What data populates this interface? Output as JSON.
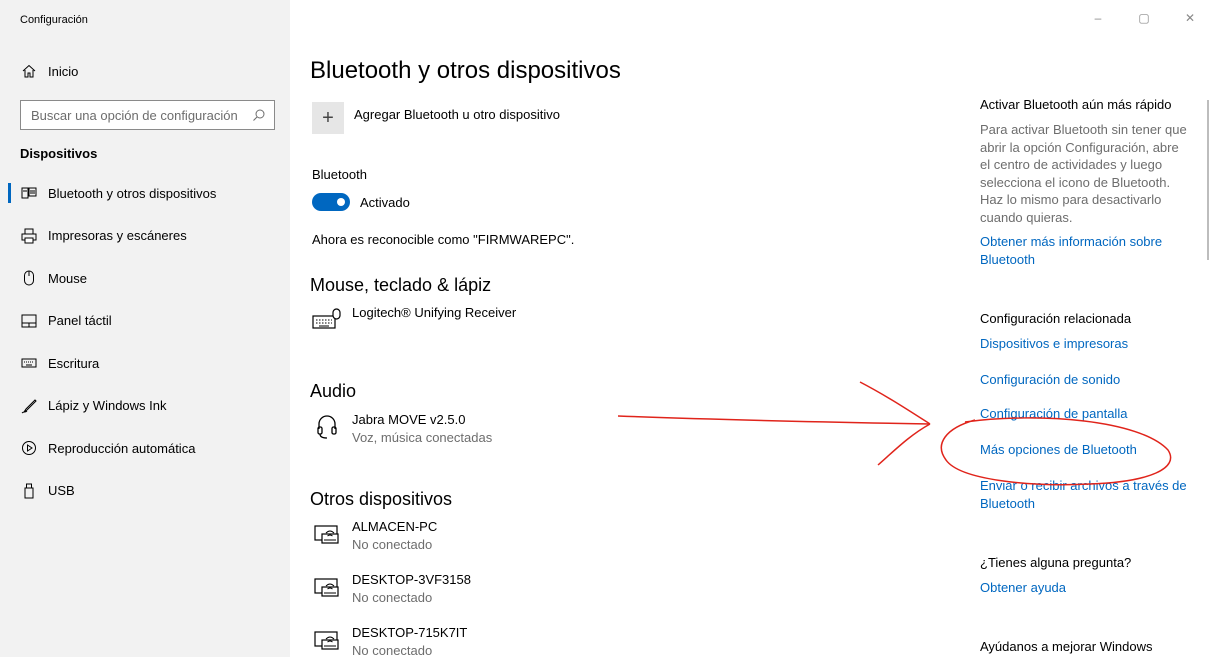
{
  "window": {
    "title": "Configuración",
    "controls": {
      "minimize": "–",
      "maximize": "▢",
      "close": "✕"
    }
  },
  "sidebar": {
    "home": "Inicio",
    "search_placeholder": "Buscar una opción de configuración",
    "section": "Dispositivos",
    "items": [
      {
        "label": "Bluetooth y otros dispositivos",
        "icon": "bluetooth-devices-icon",
        "active": true
      },
      {
        "label": "Impresoras y escáneres",
        "icon": "printer-icon"
      },
      {
        "label": "Mouse",
        "icon": "mouse-icon"
      },
      {
        "label": "Panel táctil",
        "icon": "touchpad-icon"
      },
      {
        "label": "Escritura",
        "icon": "keyboard-icon"
      },
      {
        "label": "Lápiz y Windows Ink",
        "icon": "pen-icon"
      },
      {
        "label": "Reproducción automática",
        "icon": "autoplay-icon"
      },
      {
        "label": "USB",
        "icon": "usb-icon"
      }
    ]
  },
  "main": {
    "title": "Bluetooth y otros dispositivos",
    "add_label": "Agregar Bluetooth u otro dispositivo",
    "bluetooth_label": "Bluetooth",
    "toggle_state": "Activado",
    "discoverable": "Ahora es reconocible como \"FIRMWAREPC\".",
    "groups": {
      "mouse": {
        "title": "Mouse, teclado & lápiz",
        "devices": [
          {
            "name": "Logitech® Unifying Receiver",
            "status": "",
            "icon": "keyboard-mouse-icon"
          }
        ]
      },
      "audio": {
        "title": "Audio",
        "devices": [
          {
            "name": "Jabra MOVE v2.5.0",
            "status": "Voz, música conectadas",
            "icon": "headphones-icon"
          }
        ]
      },
      "other": {
        "title": "Otros dispositivos",
        "devices": [
          {
            "name": "ALMACEN-PC",
            "status": "No conectado",
            "icon": "network-pc-icon"
          },
          {
            "name": "DESKTOP-3VF3158",
            "status": "No conectado",
            "icon": "network-pc-icon"
          },
          {
            "name": "DESKTOP-715K7IT",
            "status": "No conectado",
            "icon": "network-pc-icon"
          }
        ]
      }
    }
  },
  "right": {
    "fast_title": "Activar Bluetooth aún más rápido",
    "fast_text": "Para activar Bluetooth sin tener que abrir la opción Configuración, abre el centro de actividades y luego selecciona el icono de Bluetooth. Haz lo mismo para desactivarlo cuando quieras.",
    "fast_link": "Obtener más información sobre Bluetooth",
    "related_title": "Configuración relacionada",
    "related_links": [
      "Dispositivos e impresoras",
      "Configuración de sonido",
      "Configuración de pantalla",
      "Más opciones de Bluetooth",
      "Enviar o recibir archivos a través de Bluetooth"
    ],
    "question_title": "¿Tienes alguna pregunta?",
    "question_link": "Obtener ayuda",
    "improve_title": "Ayúdanos a mejorar Windows"
  },
  "colors": {
    "accent": "#0067c0",
    "sidebar_bg": "#f2f2f2",
    "annotation": "#e0241b"
  }
}
